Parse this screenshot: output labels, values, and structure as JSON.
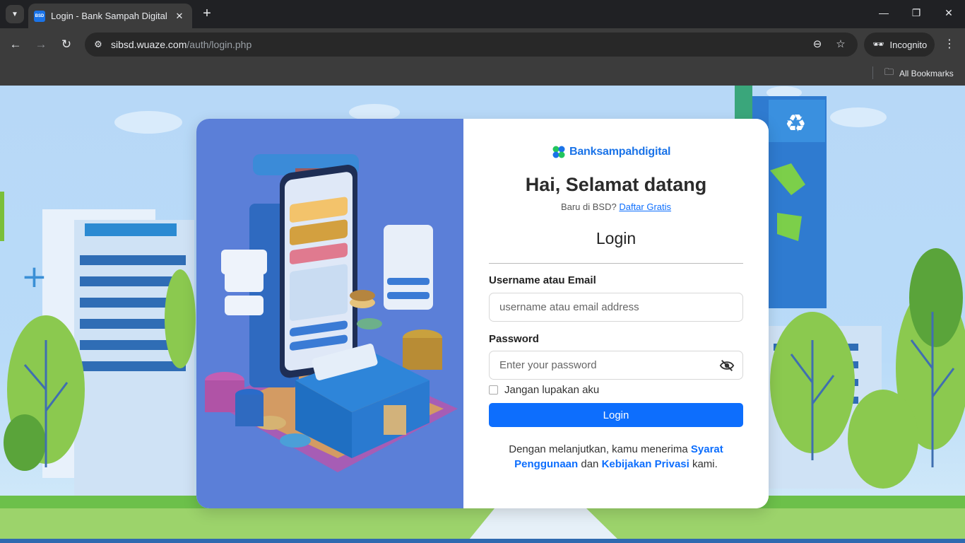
{
  "browser": {
    "tab_title": "Login - Bank Sampah Digital",
    "favicon_text": "BSD",
    "url_host": "sibsd.wuaze.com",
    "url_path": "/auth/login.php",
    "incognito_label": "Incognito",
    "bookmarks_label": "All Bookmarks"
  },
  "brand": {
    "name": "Banksampahdigital",
    "primary_color": "#1a73e8"
  },
  "form": {
    "welcome": "Hai, Selamat datang",
    "new_prompt": "Baru di BSD?",
    "signup_link": "Daftar Gratis",
    "title": "Login",
    "username_label": "Username atau Email",
    "username_placeholder": "username atau email address",
    "password_label": "Password",
    "password_placeholder": "Enter your password",
    "remember_label": "Jangan lupakan aku",
    "submit_label": "Login",
    "terms_prefix": "Dengan melanjutkan, kamu menerima",
    "terms_link": "Syarat Penggunaan",
    "terms_and": "dan",
    "privacy_link": "Kebijakan Privasi",
    "terms_suffix": "kami.",
    "button_color": "#0d6efd"
  }
}
